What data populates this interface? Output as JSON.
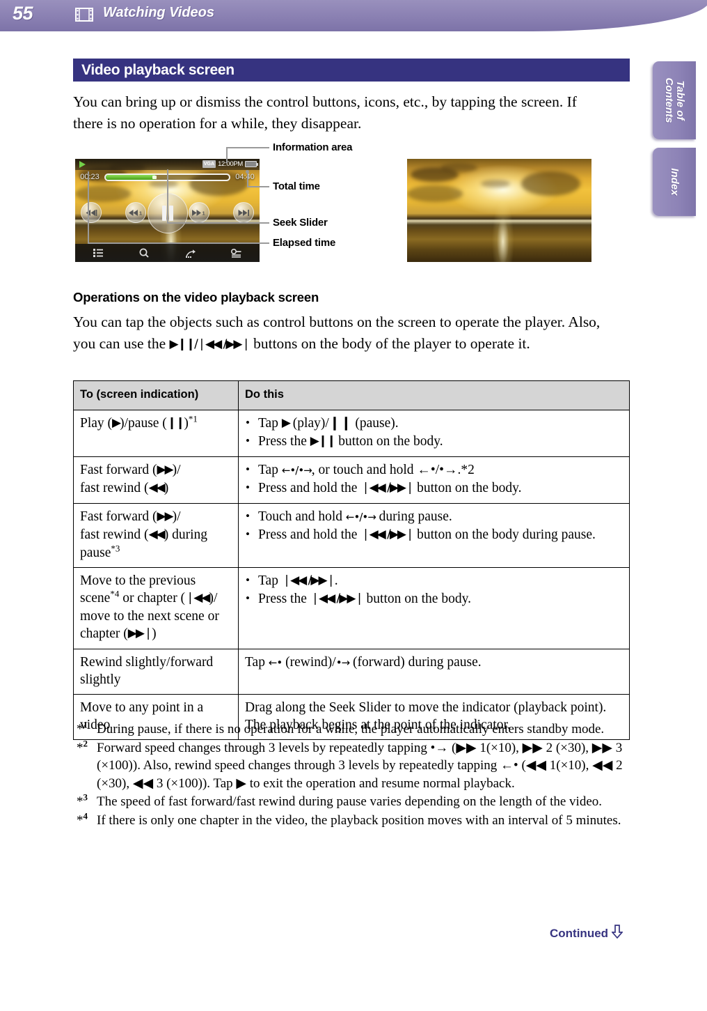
{
  "header": {
    "page_number": "55",
    "icon": "film-strip-icon",
    "title": "Watching Videos"
  },
  "side_tabs": [
    {
      "label": "Table of\nContents",
      "name": "table-of-contents-tab"
    },
    {
      "label": "Index",
      "name": "index-tab"
    }
  ],
  "section": {
    "banner_title": "Video playback screen",
    "banner_color": "#363380",
    "intro_paragraph": "You can bring up or dismiss the control buttons, icons, etc., by tapping the screen. If there is no operation for a while, they disappear."
  },
  "player_mockup": {
    "playing_icon": "play-triangle-icon",
    "status_badge": "VGA",
    "clock": "12:00PM",
    "battery_icon": "battery-icon",
    "elapsed_time": "00:23",
    "total_time": "04:40",
    "seek_progress_percent": 40,
    "controls": [
      {
        "name": "previous-track-button",
        "label": "◀◀❘"
      },
      {
        "name": "fast-rewind-1-button",
        "label": "◀◀ 1"
      },
      {
        "name": "pause-button",
        "label": "pause"
      },
      {
        "name": "fast-forward-1-button",
        "label": "▶▶ 1"
      },
      {
        "name": "next-track-button",
        "label": "❘▶▶"
      }
    ],
    "bottom_bar": [
      {
        "name": "list-icon"
      },
      {
        "name": "search-icon"
      },
      {
        "name": "share-icon"
      },
      {
        "name": "options-icon"
      }
    ]
  },
  "callouts": [
    {
      "label": "Information area",
      "name": "callout-information-area"
    },
    {
      "label": "Total time",
      "name": "callout-total-time"
    },
    {
      "label": "Seek Slider",
      "name": "callout-seek-slider"
    },
    {
      "label": "Elapsed time",
      "name": "callout-elapsed-time"
    }
  ],
  "operations": {
    "subheading": "Operations on the video playback screen",
    "intro_pre": "You can tap the objects such as control buttons on the screen to operate the player. Also, you can use the ",
    "intro_glyphs": "▶❙❙/❘◀◀ /▶▶❘",
    "intro_post": " buttons on the body of the player to operate it.",
    "table": {
      "headers": [
        "To (screen indication)",
        "Do this"
      ],
      "rows": [
        {
          "to_pre": "Play (",
          "to_g1": "▶",
          "to_mid": ")/pause (",
          "to_g2": "❙❙",
          "to_post": ")",
          "to_note": "*1",
          "do_items": [
            {
              "pre": "Tap ",
              "g": "▶",
              "post": " (play)/❙❙ (pause)."
            },
            {
              "pre": "Press the ",
              "g": "▶❙❙",
              "post": " button on the body."
            }
          ]
        },
        {
          "to_pre": "Fast forward (",
          "to_g1": "▶▶",
          "to_mid": ")/",
          "to_line2_pre": "fast rewind (",
          "to_g2": "◀◀",
          "to_post": ")",
          "to_note": "",
          "do_items": [
            {
              "pre": "Tap ",
              "g": "←•/•→",
              "post": ", or touch and hold ←•/•→.*2"
            },
            {
              "pre": "Press and hold the ",
              "g": "❘◀◀ /▶▶❘",
              "post": " button on the body."
            }
          ]
        },
        {
          "to_pre": "Fast forward (",
          "to_g1": "▶▶",
          "to_mid": ")/",
          "to_line2_pre": "fast rewind (",
          "to_g2": "◀◀",
          "to_post": ") during pause",
          "to_note": "*3",
          "do_items": [
            {
              "pre": "Touch and hold ",
              "g": "←•/•→",
              "post": " during pause."
            },
            {
              "pre": "Press and hold the ",
              "g": "❘◀◀ /▶▶❘",
              "post": " button on the body during pause."
            }
          ]
        },
        {
          "to_pre": "Move to the previous scene",
          "to_note": "*4",
          "to_mid": " or chapter (",
          "to_g1": "❘◀◀",
          "to_post": ")/ move to the next scene or chapter (",
          "to_g2": "▶▶❘",
          "to_end": ")",
          "do_items": [
            {
              "pre": "Tap ",
              "g": "❘◀◀ /▶▶❘",
              "post": "."
            },
            {
              "pre": "Press the ",
              "g": "❘◀◀ /▶▶❘",
              "post": " button on the body."
            }
          ]
        },
        {
          "to_plain": "Rewind slightly/forward slightly",
          "do_plain_pre": "Tap ",
          "do_plain_g1": "←•",
          "do_plain_mid": " (rewind)/",
          "do_plain_g2": "•→",
          "do_plain_post": " (forward) during pause."
        },
        {
          "to_plain": "Move to any point in a video",
          "do_plain_pre": "Drag along the Seek Slider to move the indicator (playback point). The playback begins at the point of the indicator."
        }
      ]
    }
  },
  "footnotes": [
    {
      "mark": "*1",
      "text": "During pause, if there is no operation for a while, the player automatically enters standby mode."
    },
    {
      "mark": "*2",
      "text": "Forward speed changes through 3 levels by repeatedly tapping •→ (▶▶ 1(×10), ▶▶ 2 (×30), ▶▶ 3 (×100)). Also, rewind speed changes through 3 levels by repeatedly tapping ←• (◀◀ 1(×10), ◀◀ 2 (×30), ◀◀ 3 (×100)). Tap ▶ to exit the operation and resume normal playback."
    },
    {
      "mark": "*3",
      "text": "The speed of fast forward/fast rewind during pause varies depending on the length of the video."
    },
    {
      "mark": "*4",
      "text": "If there is only one chapter in the video, the playback position moves with an interval of 5 minutes."
    }
  ],
  "footer": {
    "continued_label": "Continued",
    "continued_icon": "down-arrow-icon",
    "color": "#363380"
  }
}
